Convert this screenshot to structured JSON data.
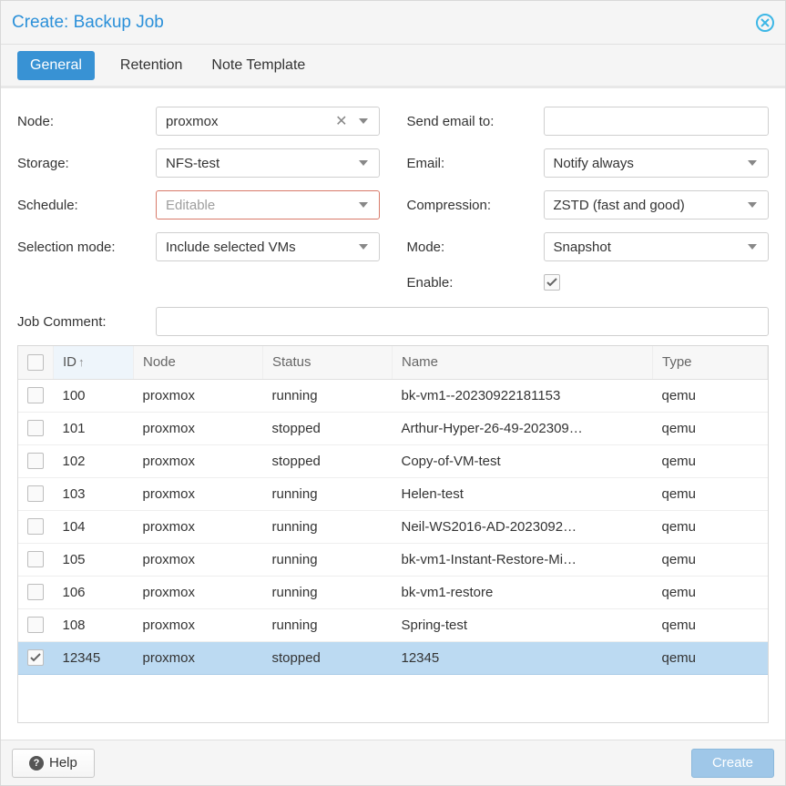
{
  "title": "Create: Backup Job",
  "tabs": [
    {
      "label": "General",
      "active": true
    },
    {
      "label": "Retention",
      "active": false
    },
    {
      "label": "Note Template",
      "active": false
    }
  ],
  "fields_left": {
    "node": {
      "label": "Node:",
      "value": "proxmox"
    },
    "storage": {
      "label": "Storage:",
      "value": "NFS-test"
    },
    "schedule": {
      "label": "Schedule:",
      "value": "Editable"
    },
    "selection_mode": {
      "label": "Selection mode:",
      "value": "Include selected VMs"
    }
  },
  "fields_right": {
    "send_email_to": {
      "label": "Send email to:",
      "value": ""
    },
    "email": {
      "label": "Email:",
      "value": "Notify always"
    },
    "compression": {
      "label": "Compression:",
      "value": "ZSTD (fast and good)"
    },
    "mode": {
      "label": "Mode:",
      "value": "Snapshot"
    },
    "enable": {
      "label": "Enable:",
      "checked": true
    }
  },
  "job_comment": {
    "label": "Job Comment:",
    "value": ""
  },
  "table": {
    "columns": {
      "id": "ID",
      "node": "Node",
      "status": "Status",
      "name": "Name",
      "type": "Type"
    },
    "rows": [
      {
        "checked": false,
        "id": "100",
        "node": "proxmox",
        "status": "running",
        "name": "bk-vm1--20230922181153",
        "type": "qemu"
      },
      {
        "checked": false,
        "id": "101",
        "node": "proxmox",
        "status": "stopped",
        "name": "Arthur-Hyper-26-49-202309…",
        "type": "qemu"
      },
      {
        "checked": false,
        "id": "102",
        "node": "proxmox",
        "status": "stopped",
        "name": "Copy-of-VM-test",
        "type": "qemu"
      },
      {
        "checked": false,
        "id": "103",
        "node": "proxmox",
        "status": "running",
        "name": "Helen-test",
        "type": "qemu"
      },
      {
        "checked": false,
        "id": "104",
        "node": "proxmox",
        "status": "running",
        "name": "Neil-WS2016-AD-2023092…",
        "type": "qemu"
      },
      {
        "checked": false,
        "id": "105",
        "node": "proxmox",
        "status": "running",
        "name": "bk-vm1-Instant-Restore-Mi…",
        "type": "qemu"
      },
      {
        "checked": false,
        "id": "106",
        "node": "proxmox",
        "status": "running",
        "name": "bk-vm1-restore",
        "type": "qemu"
      },
      {
        "checked": false,
        "id": "108",
        "node": "proxmox",
        "status": "running",
        "name": "Spring-test",
        "type": "qemu"
      },
      {
        "checked": true,
        "id": "12345",
        "node": "proxmox",
        "status": "stopped",
        "name": "12345",
        "type": "qemu"
      }
    ]
  },
  "footer": {
    "help": "Help",
    "create": "Create"
  }
}
